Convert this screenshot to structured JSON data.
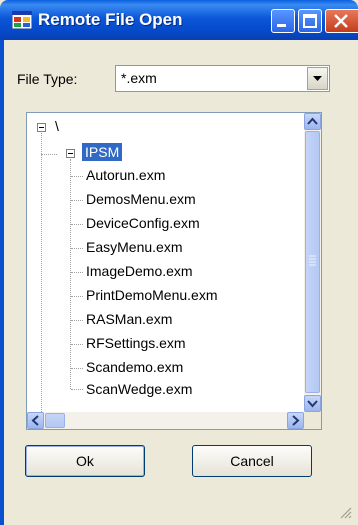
{
  "window": {
    "title": "Remote File Open",
    "colors": {
      "titlebar": "#0a57d8",
      "face": "#ece9d8",
      "selection": "#316ac5"
    }
  },
  "file_type": {
    "label": "File Type:",
    "value": "*.exm"
  },
  "tree": {
    "root": "\\",
    "folder": "IPSM",
    "files": [
      "Autorun.exm",
      "DemosMenu.exm",
      "DeviceConfig.exm",
      "EasyMenu.exm",
      "ImageDemo.exm",
      "PrintDemoMenu.exm",
      "RASMan.exm",
      "RFSettings.exm",
      "Scandemo.exm",
      "ScanWedge.exm"
    ]
  },
  "buttons": {
    "ok": "Ok",
    "cancel": "Cancel"
  },
  "icons": [
    "app-icon",
    "minimize-icon",
    "maximize-icon",
    "close-icon",
    "dropdown-arrow-icon",
    "scroll-up-icon",
    "scroll-down-icon",
    "scroll-left-icon",
    "scroll-right-icon",
    "resize-grip-icon"
  ]
}
